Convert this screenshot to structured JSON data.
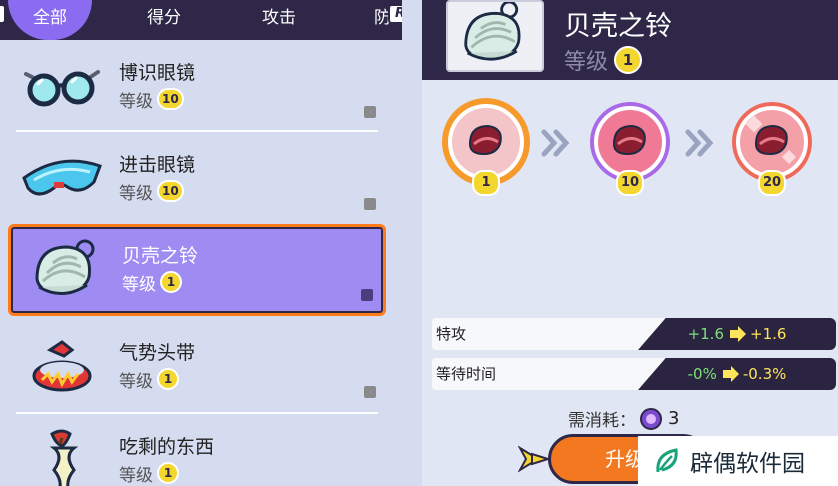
{
  "tabs": {
    "all": "全部",
    "score": "得分",
    "attack": "攻击",
    "defense": "防",
    "r_button": "R"
  },
  "items": [
    {
      "name": "博识眼镜",
      "level_label": "等级",
      "level": "10",
      "icon": "glasses-icon"
    },
    {
      "name": "进击眼镜",
      "level_label": "等级",
      "level": "10",
      "icon": "sport-goggles-icon"
    },
    {
      "name": "贝壳之铃",
      "level_label": "等级",
      "level": "1",
      "icon": "shell-bell-icon",
      "selected": true
    },
    {
      "name": "气势头带",
      "level_label": "等级",
      "level": "1",
      "icon": "headband-icon"
    },
    {
      "name": "吃剩的东西",
      "level_label": "等级",
      "level": "1",
      "icon": "apple-core-icon"
    }
  ],
  "detail": {
    "name": "贝壳之铃",
    "level_label": "等级",
    "level": "1",
    "stages": [
      "1",
      "10",
      "20"
    ],
    "stats": [
      {
        "label": "特攻",
        "from": "+1.6",
        "to": "+1.6"
      },
      {
        "label": "等待时间",
        "from": "-0%",
        "to": "-0.3%"
      }
    ],
    "cost_label": "需消耗：",
    "cost_value": "3",
    "upgrade_label": "升级"
  },
  "watermark": {
    "text": "辟偶软件园"
  },
  "colors": {
    "header_bg": "#2e2748",
    "tab_active": "#8b6cf0",
    "selected_bg": "#9f8cf3",
    "selected_border": "#ff7a1a",
    "level_badge": "#f3d72e",
    "stat_green": "#7fe07a",
    "upgrade_button": "#f4781f"
  }
}
